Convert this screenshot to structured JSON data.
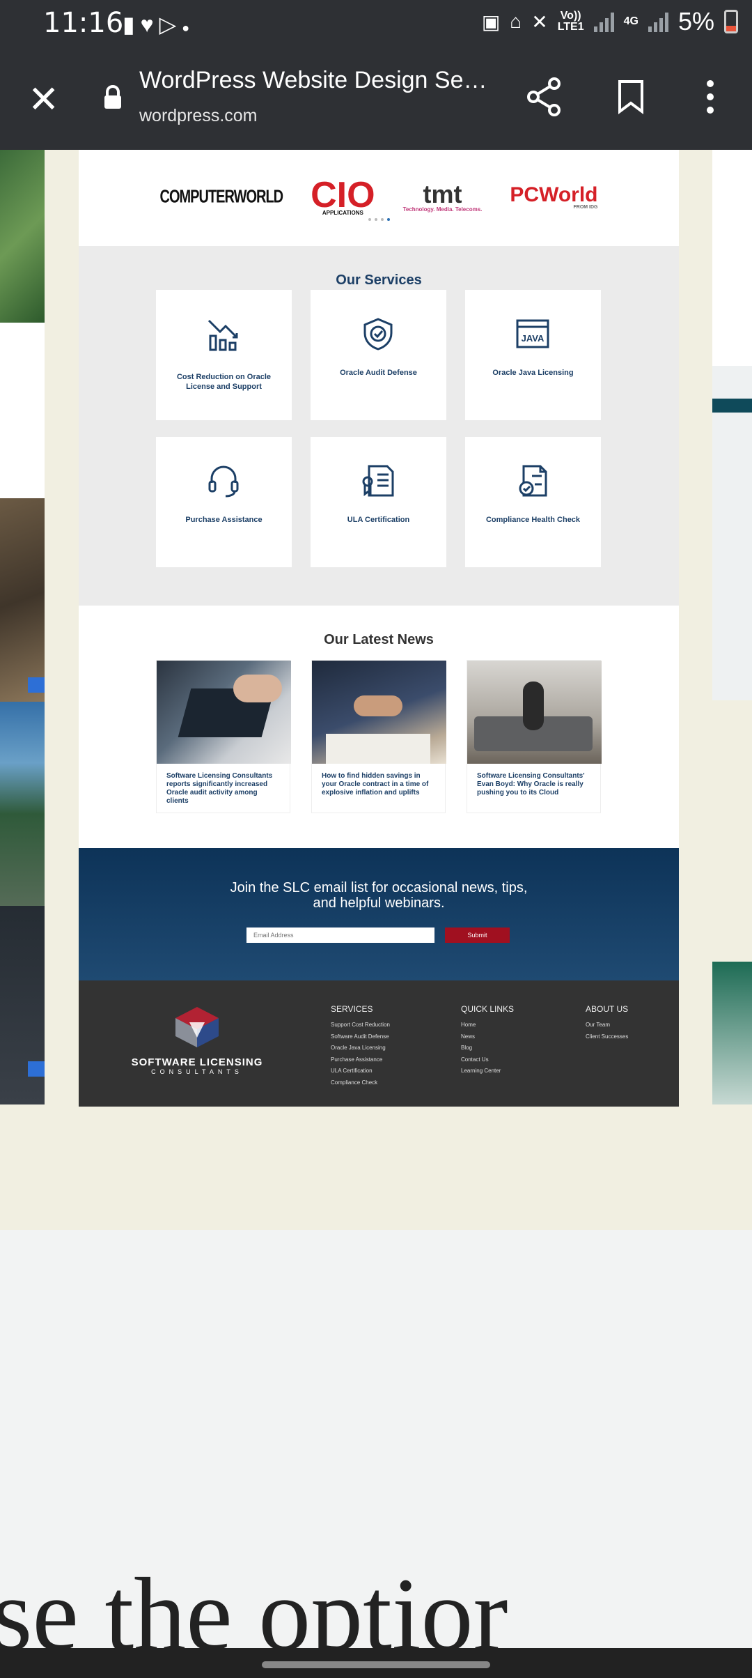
{
  "status_bar": {
    "time": "11:16",
    "left_icons": [
      "alert-icon",
      "pocket-icon",
      "play-store-icon",
      "dot-icon"
    ],
    "network_top": "Vo))",
    "network_bottom": "LTE1",
    "network_4g": "4G",
    "battery": "5%"
  },
  "toolbar": {
    "title": "WordPress Website Design Ser...",
    "url": "wordpress.com"
  },
  "site": {
    "services_title": "Our Services",
    "services": [
      {
        "label": "Cost Reduction on Oracle License and Support",
        "icon": "chart-down-icon"
      },
      {
        "label": "Oracle Audit Defense",
        "icon": "shield-check-icon"
      },
      {
        "label": "Oracle Java Licensing",
        "icon": "java-icon"
      },
      {
        "label": "Purchase Assistance",
        "icon": "headset-icon"
      },
      {
        "label": "ULA Certification",
        "icon": "certificate-icon"
      },
      {
        "label": "Compliance Health Check",
        "icon": "document-check-icon"
      }
    ],
    "news_title": "Our Latest News",
    "news": [
      {
        "caption": "Software Licensing Consultants reports significantly increased Oracle audit activity among clients"
      },
      {
        "caption": "How to find hidden savings in your Oracle contract in a time of explosive inflation and uplifts"
      },
      {
        "caption": "Software Licensing Consultants' Evan Boyd: Why Oracle is really pushing you to its Cloud"
      }
    ],
    "signup_text": "Join the SLC email list for occasional news, tips, and helpful webinars.",
    "email_placeholder": "Email Address",
    "submit_label": "Submit",
    "footer": {
      "brand_name": "SOFTWARE LICENSING",
      "brand_sub": "CONSULTANTS",
      "services_heading": "SERVICES",
      "services_links": [
        "Support Cost Reduction",
        "Software Audit Defense",
        "Oracle Java Licensing",
        "Purchase Assistance",
        "ULA Certification",
        "Compliance Check"
      ],
      "quick_heading": "QUICK LINKS",
      "quick_links": [
        "Home",
        "News",
        "Blog",
        "Contact Us",
        "Learning Center"
      ],
      "about_heading": "ABOUT US",
      "about_links": [
        "Our Team",
        "Client Successes"
      ]
    }
  },
  "partial_heading": "se the optior",
  "colors": {
    "brand_navy": "#1c3f66",
    "submit_red": "#a01020",
    "page_bg": "#f1efe1"
  }
}
